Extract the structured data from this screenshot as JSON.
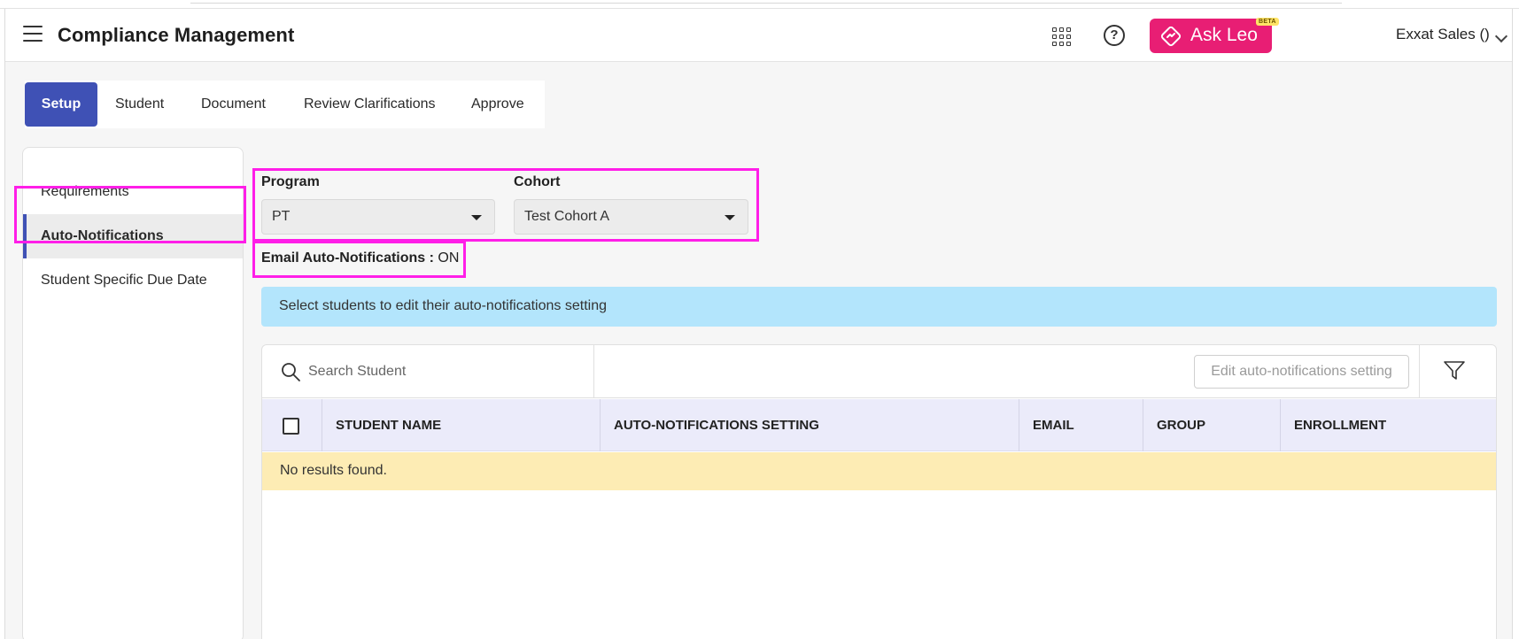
{
  "header": {
    "title": "Compliance Management",
    "ask_leo_label": "Ask Leo",
    "beta_label": "BETA",
    "user_name": "Exxat Sales ()"
  },
  "tabs": [
    {
      "label": "Setup",
      "active": true
    },
    {
      "label": "Student"
    },
    {
      "label": "Document"
    },
    {
      "label": "Review Clarifications"
    },
    {
      "label": "Approve"
    }
  ],
  "sidebar": {
    "items": [
      {
        "label": "Requirements"
      },
      {
        "label": "Auto-Notifications",
        "active": true
      },
      {
        "label": "Student Specific Due Date"
      }
    ]
  },
  "filters": {
    "program_label": "Program",
    "program_value": "PT",
    "cohort_label": "Cohort",
    "cohort_value": "Test Cohort A"
  },
  "email_status": {
    "label": "Email Auto-Notifications :",
    "value": "ON"
  },
  "info_banner": "Select students to edit their auto-notifications setting",
  "toolbar": {
    "search_placeholder": "Search Student",
    "edit_button": "Edit auto-notifications setting"
  },
  "table": {
    "columns": [
      "STUDENT NAME",
      "AUTO-NOTIFICATIONS SETTING",
      "EMAIL",
      "GROUP",
      "ENROLLMENT"
    ],
    "rows": [],
    "empty_message": "No results found."
  },
  "colors": {
    "primary": "#3f51b5",
    "ask_leo": "#e81e74",
    "highlight": "#ff1ee8",
    "info_banner": "#b3e5fc",
    "no_results": "#fdecb4"
  }
}
